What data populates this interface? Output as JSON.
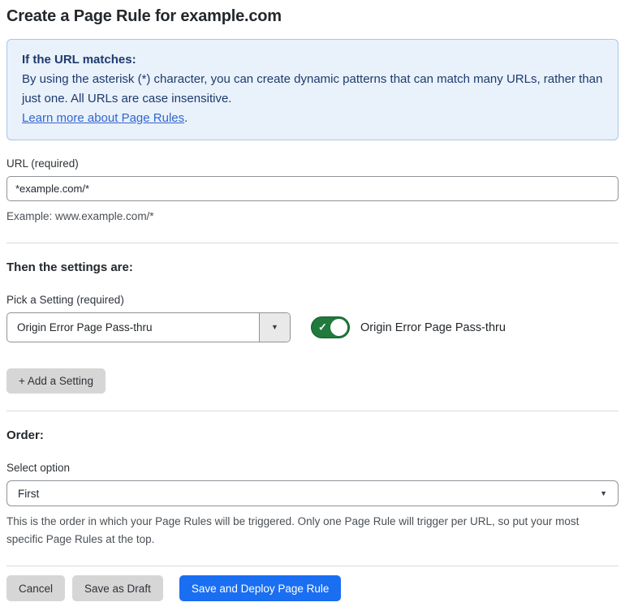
{
  "page": {
    "title": "Create a Page Rule for example.com"
  },
  "info_box": {
    "heading": "If the URL matches:",
    "body": "By using the asterisk (*) character, you can create dynamic patterns that can match many URLs, rather than just one. All URLs are case insensitive.",
    "link_label": "Learn more about Page Rules",
    "link_suffix": "."
  },
  "url_section": {
    "label": "URL (required)",
    "value": "*example.com/*",
    "help": "Example: www.example.com/*"
  },
  "settings_section": {
    "heading": "Then the settings are:",
    "pick_label": "Pick a Setting (required)",
    "selected_setting": "Origin Error Page Pass-thru",
    "dropdown_caret": "▼",
    "toggle_state": "on",
    "toggle_check": "✓",
    "toggle_label": "Origin Error Page Pass-thru",
    "add_button_label": "+ Add a Setting"
  },
  "order_section": {
    "heading": "Order:",
    "select_label": "Select option",
    "selected_option": "First",
    "select_caret": "▼",
    "help": "This is the order in which your Page Rules will be triggered. Only one Page Rule will trigger per URL, so put your most specific Page Rules at the top."
  },
  "footer": {
    "cancel_label": "Cancel",
    "save_draft_label": "Save as Draft",
    "save_deploy_label": "Save and Deploy Page Rule"
  },
  "colors": {
    "primary_blue": "#1a6ef2",
    "toggle_green": "#1f7a3c",
    "info_bg": "#e9f1fb",
    "info_border": "#aac6e8",
    "info_text": "#1d3b6d",
    "link_blue": "#3266cf",
    "button_gray": "#d6d6d6"
  }
}
